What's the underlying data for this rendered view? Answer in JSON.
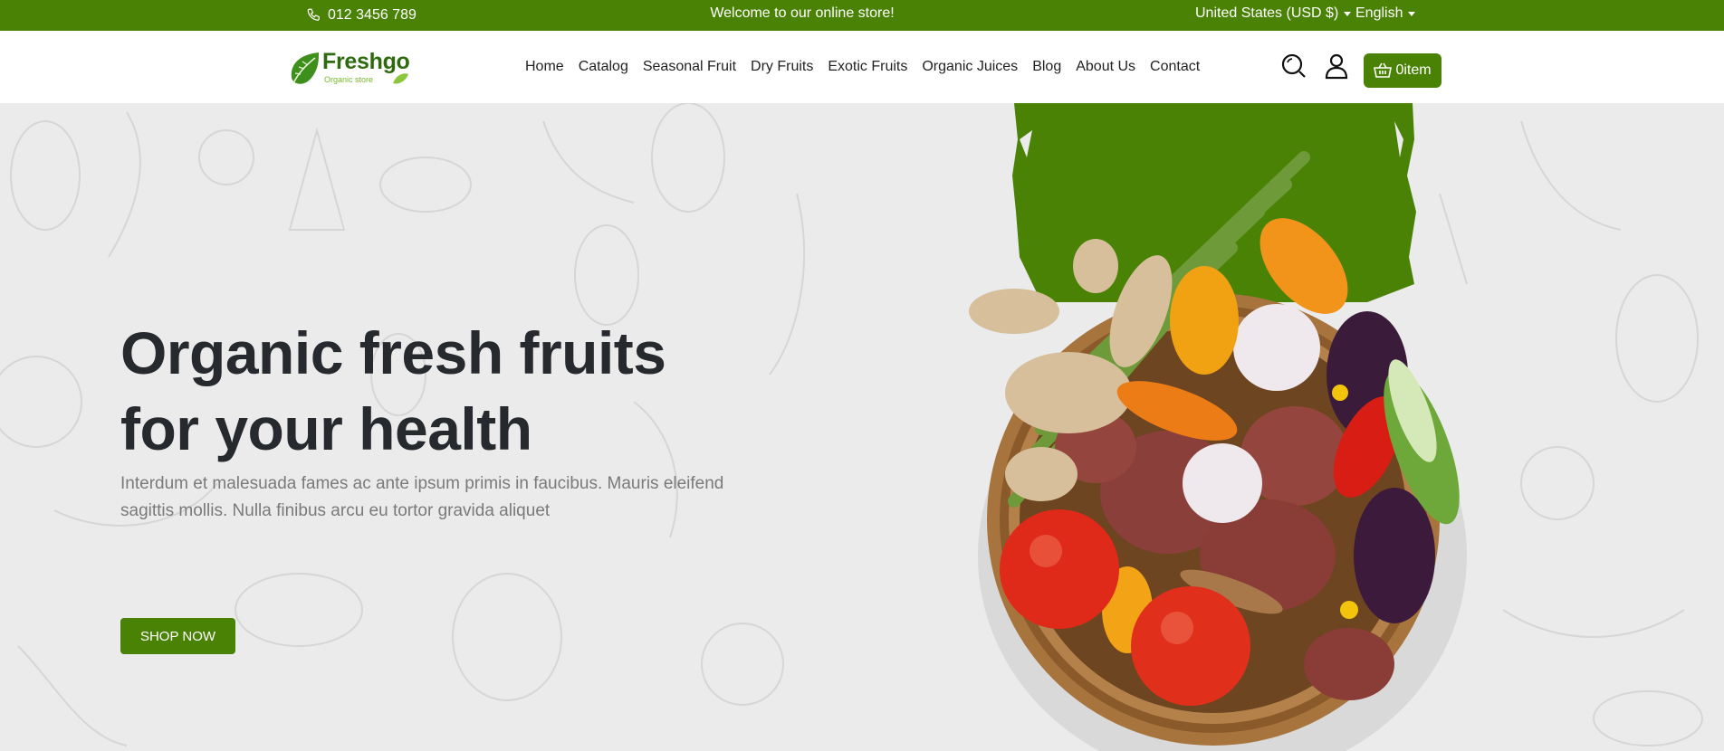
{
  "topbar": {
    "phone": "012 3456 789",
    "welcome": "Welcome to our online store!",
    "currency": "United States (USD $)",
    "language": "English"
  },
  "header": {
    "logo_name": "Freshgo",
    "logo_tagline": "Organic store",
    "nav": [
      "Home",
      "Catalog",
      "Seasonal Fruit",
      "Dry Fruits",
      "Exotic Fruits",
      "Organic Juices",
      "Blog",
      "About Us",
      "Contact"
    ],
    "cart_label": "0item",
    "icons": {
      "search": "search-icon",
      "account": "user-icon",
      "cart": "basket-icon"
    }
  },
  "hero": {
    "title_line1": "Organic fresh fruits",
    "title_line2": "for your health",
    "description": "Interdum et malesuada fames ac ante ipsum primis in faucibus. Mauris eleifend sagittis mollis. Nulla finibus arcu eu tortor gravida aliquet",
    "button": "SHOP NOW"
  },
  "colors": {
    "brand_green": "#4a8206",
    "dark_text": "#262a2f",
    "muted_text": "#7a7a7a",
    "hero_bg": "#ebebeb"
  }
}
